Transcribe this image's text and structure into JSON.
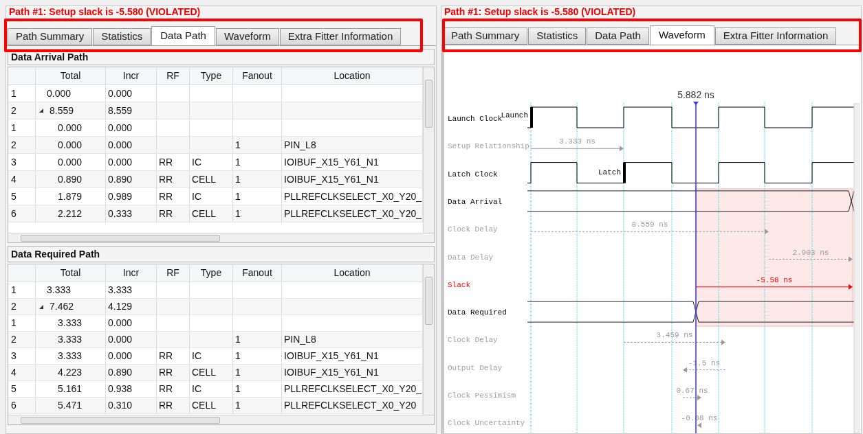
{
  "panels": [
    {
      "title": "Path #1: Setup slack is -5.580 (VIOLATED)",
      "tabs": [
        {
          "label": "Path Summary",
          "selected": false
        },
        {
          "label": "Statistics",
          "selected": false
        },
        {
          "label": "Data Path",
          "selected": true
        },
        {
          "label": "Waveform",
          "selected": false
        },
        {
          "label": "Extra Fitter Information",
          "selected": false
        }
      ],
      "sections": [
        {
          "title": "Data Arrival Path",
          "columns": [
            "Total",
            "Incr",
            "RF",
            "Type",
            "Fanout",
            "Location"
          ],
          "rows": [
            {
              "index": "1",
              "total": "0.000",
              "incr": "0.000"
            },
            {
              "index": "2",
              "total": "8.559",
              "incr": "8.559",
              "expanded": true,
              "children": [
                {
                  "index": "1",
                  "total": "0.000",
                  "incr": "0.000"
                },
                {
                  "index": "2",
                  "total": "0.000",
                  "incr": "0.000",
                  "fanout": "1",
                  "location": "PIN_L8"
                },
                {
                  "index": "3",
                  "total": "0.000",
                  "incr": "0.000",
                  "rf": "RR",
                  "type": "IC",
                  "fanout": "1",
                  "location": "IOIBUF_X15_Y61_N1"
                },
                {
                  "index": "4",
                  "total": "0.890",
                  "incr": "0.890",
                  "rf": "RR",
                  "type": "CELL",
                  "fanout": "1",
                  "location": "IOIBUF_X15_Y61_N1"
                },
                {
                  "index": "5",
                  "total": "1.879",
                  "incr": "0.989",
                  "rf": "RR",
                  "type": "IC",
                  "fanout": "1",
                  "location": "PLLREFCLKSELECT_X0_Y20_"
                },
                {
                  "index": "6",
                  "total": "2.212",
                  "incr": "0.333",
                  "rf": "RR",
                  "type": "CELL",
                  "fanout": "1",
                  "location": "PLLREFCLKSELECT_X0_Y20_"
                }
              ]
            }
          ]
        },
        {
          "title": "Data Required Path",
          "columns": [
            "Total",
            "Incr",
            "RF",
            "Type",
            "Fanout",
            "Location"
          ],
          "rows": [
            {
              "index": "1",
              "total": "3.333",
              "incr": "3.333"
            },
            {
              "index": "2",
              "total": "7.462",
              "incr": "4.129",
              "expanded": true,
              "children": [
                {
                  "index": "1",
                  "total": "3.333",
                  "incr": "0.000"
                },
                {
                  "index": "2",
                  "total": "3.333",
                  "incr": "0.000",
                  "fanout": "1",
                  "location": "PIN_L8"
                },
                {
                  "index": "3",
                  "total": "3.333",
                  "incr": "0.000",
                  "rf": "RR",
                  "type": "IC",
                  "fanout": "1",
                  "location": "IOIBUF_X15_Y61_N1"
                },
                {
                  "index": "4",
                  "total": "4.223",
                  "incr": "0.890",
                  "rf": "RR",
                  "type": "CELL",
                  "fanout": "1",
                  "location": "IOIBUF_X15_Y61_N1"
                },
                {
                  "index": "5",
                  "total": "5.161",
                  "incr": "0.938",
                  "rf": "RR",
                  "type": "IC",
                  "fanout": "1",
                  "location": "PLLREFCLKSELECT_X0_Y20_"
                },
                {
                  "index": "6",
                  "total": "5.471",
                  "incr": "0.310",
                  "rf": "RR",
                  "type": "CELL",
                  "fanout": "1",
                  "location": "PLLREFCLKSELECT_X0_Y20"
                }
              ]
            }
          ]
        }
      ]
    },
    {
      "title": "Path #1: Setup slack is -5.580 (VIOLATED)",
      "tabs": [
        {
          "label": "Path Summary",
          "selected": false
        },
        {
          "label": "Statistics",
          "selected": false
        },
        {
          "label": "Data Path",
          "selected": false
        },
        {
          "label": "Waveform",
          "selected": true
        },
        {
          "label": "Extra Fitter Information",
          "selected": false
        }
      ],
      "waveform": {
        "marker": "5.882 ns",
        "rows": [
          {
            "label": "Launch Clock",
            "kind": "clock",
            "edge_label": "Launch"
          },
          {
            "label": "Setup Relationship",
            "kind": "interval",
            "value": "3.333 ns"
          },
          {
            "label": "Latch Clock",
            "kind": "clock",
            "edge_label": "Latch"
          },
          {
            "label": "Data Arrival",
            "kind": "bus"
          },
          {
            "label": "Clock Delay",
            "kind": "interval",
            "value": "8.559 ns"
          },
          {
            "label": "Data Delay",
            "kind": "interval",
            "value": "2.903 ns"
          },
          {
            "label": "Slack",
            "kind": "slack",
            "value": "-5.58 ns"
          },
          {
            "label": "Data Required",
            "kind": "bus"
          },
          {
            "label": "Clock Delay",
            "kind": "interval",
            "value": "3.459 ns"
          },
          {
            "label": "Output Delay",
            "kind": "interval",
            "value": "-1.5 ns"
          },
          {
            "label": "Clock Pessimism",
            "kind": "interval",
            "value": "0.67 ns"
          },
          {
            "label": "Clock Uncertainty",
            "kind": "interval",
            "value": "-0.08 ns"
          }
        ]
      }
    }
  ]
}
